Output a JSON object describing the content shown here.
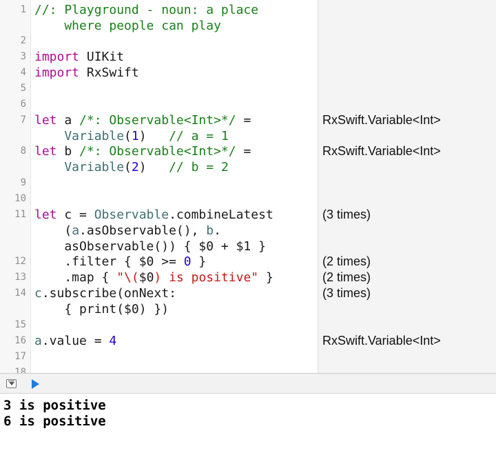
{
  "editor": {
    "line_numbers": [
      "1",
      "2",
      "3",
      "4",
      "5",
      "6",
      "7",
      "8",
      "9",
      "10",
      "11",
      "12",
      "13",
      "14",
      "15",
      "16",
      "17",
      "18"
    ],
    "lines": {
      "l1a": "//: Playground - noun: a place",
      "l1b": "    where people can play",
      "l3_kw": "import",
      "l3_rest": " UIKit",
      "l4_kw": "import",
      "l4_rest": " RxSwift",
      "l7a_kw": "let",
      "l7a_mid": " a ",
      "l7a_cm": "/*: Observable<Int>*/",
      "l7a_end": " =",
      "l7b_ty": "    Variable",
      "l7b_p1": "(",
      "l7b_num": "1",
      "l7b_p2": ")   ",
      "l7b_cm": "// a = 1",
      "l8a_kw": "let",
      "l8a_mid": " b ",
      "l8a_cm": "/*: Observable<Int>*/",
      "l8a_end": " =",
      "l8b_ty": "    Variable",
      "l8b_p1": "(",
      "l8b_num": "2",
      "l8b_p2": ")   ",
      "l8b_cm": "// b = 2",
      "l11a_kw": "let",
      "l11a_mid": " c = ",
      "l11a_ty": "Observable",
      "l11a_end": ".combineLatest",
      "l11b_p1": "    (",
      "l11b_ty1": "a",
      "l11b_mid": ".asObservable(), ",
      "l11b_ty2": "b",
      "l11b_end": ".",
      "l11c": "    asObservable()) { $0 + $1 }",
      "l12_pre": "    .filter { $0 >= ",
      "l12_num": "0",
      "l12_end": " }",
      "l13_pre": "    .map { ",
      "l13_st1": "\"\\(",
      "l13_mid": "$0",
      "l13_st2": ") is positive\"",
      "l13_end": " }",
      "l14a_ty": "c",
      "l14a_end": ".subscribe(onNext:",
      "l14b": "    { print($0) })",
      "l16_ty": "a",
      "l16_mid": ".value = ",
      "l16_num": "4"
    }
  },
  "results": {
    "r7": "RxSwift.Variable<Int>",
    "r8": "RxSwift.Variable<Int>",
    "r11": "(3 times)",
    "r12": "(2 times)",
    "r13": "(2 times)",
    "r14": "(3 times)",
    "r16": "RxSwift.Variable<Int>"
  },
  "toolbar": {
    "toggle_icon": "debug-area-toggle-icon",
    "run_icon": "play-icon",
    "run_color": "#1f7ae0"
  },
  "console": {
    "output": [
      "3 is positive",
      "6 is positive"
    ]
  }
}
